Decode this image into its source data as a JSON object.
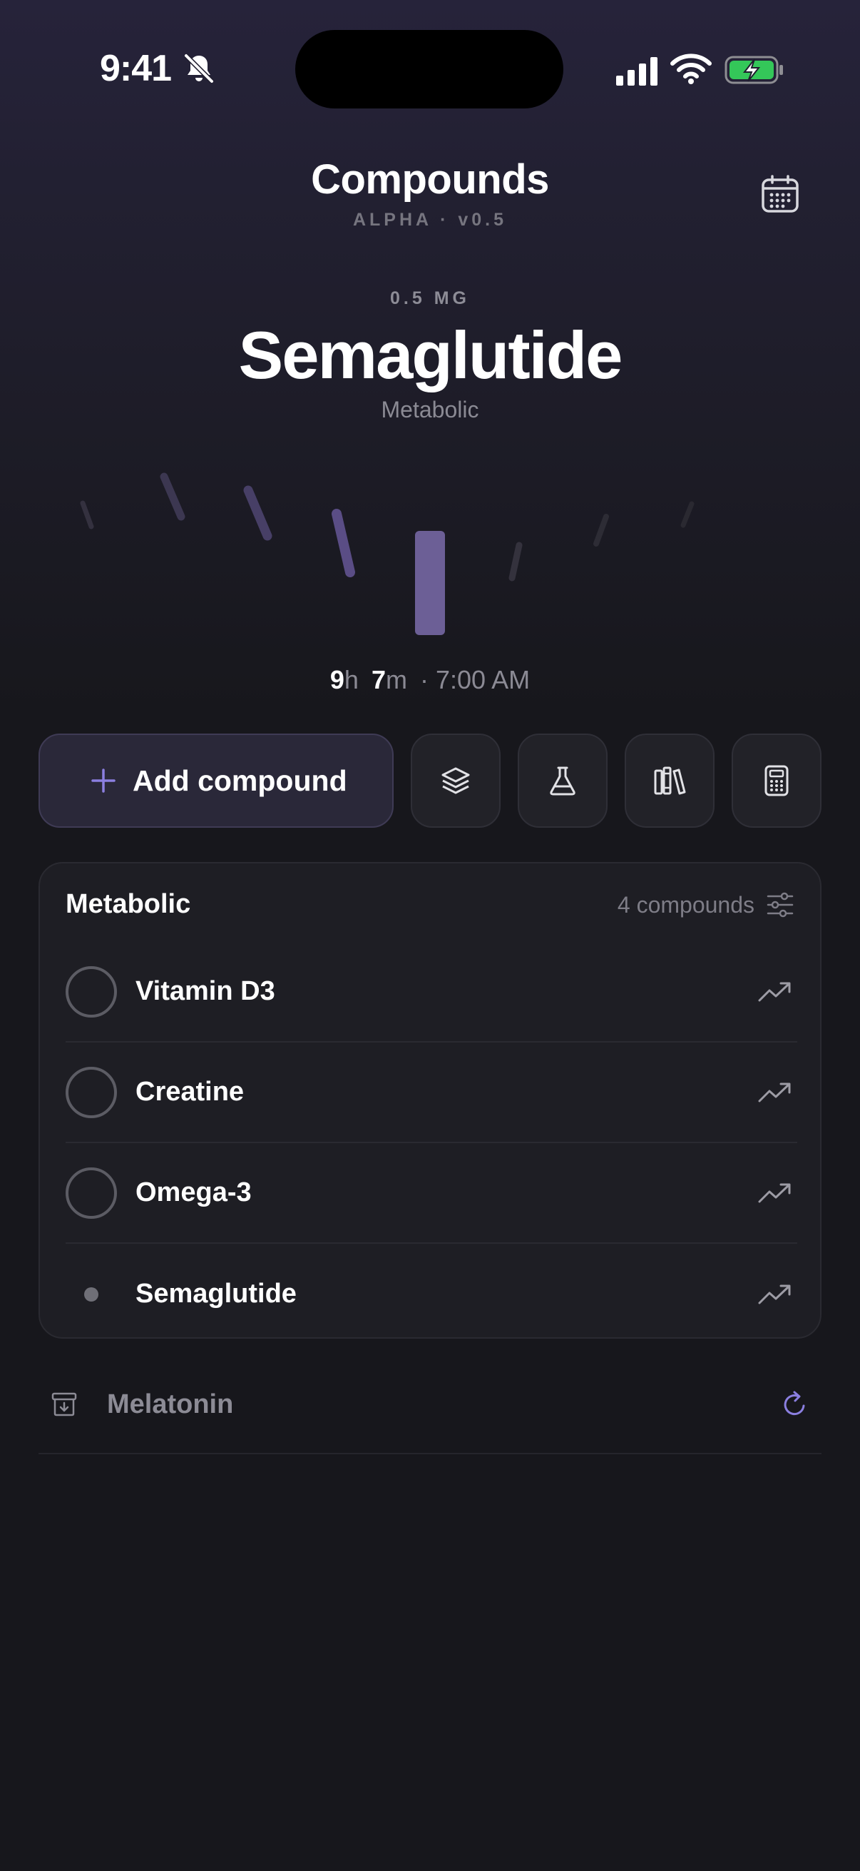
{
  "status": {
    "time": "9:41"
  },
  "header": {
    "title": "Compounds",
    "subtitle": "ALPHA · v0.5"
  },
  "hero": {
    "dose": "0.5 MG",
    "name": "Semaglutide",
    "category": "Metabolic",
    "countdown": {
      "hours": "9",
      "hours_unit": "h",
      "minutes": "7",
      "minutes_unit": "m",
      "time": "· 7:00 AM"
    }
  },
  "actions": {
    "add_label": "Add compound"
  },
  "group": {
    "title": "Metabolic",
    "count": "4 compounds",
    "items": [
      {
        "name": "Vitamin D3",
        "state": "unchecked"
      },
      {
        "name": "Creatine",
        "state": "unchecked"
      },
      {
        "name": "Omega-3",
        "state": "unchecked"
      },
      {
        "name": "Semaglutide",
        "state": "active"
      }
    ]
  },
  "archived": {
    "name": "Melatonin"
  },
  "colors": {
    "accent": "#8b7fe0",
    "battery": "#34c759",
    "dial_active": "#6c5f96"
  }
}
